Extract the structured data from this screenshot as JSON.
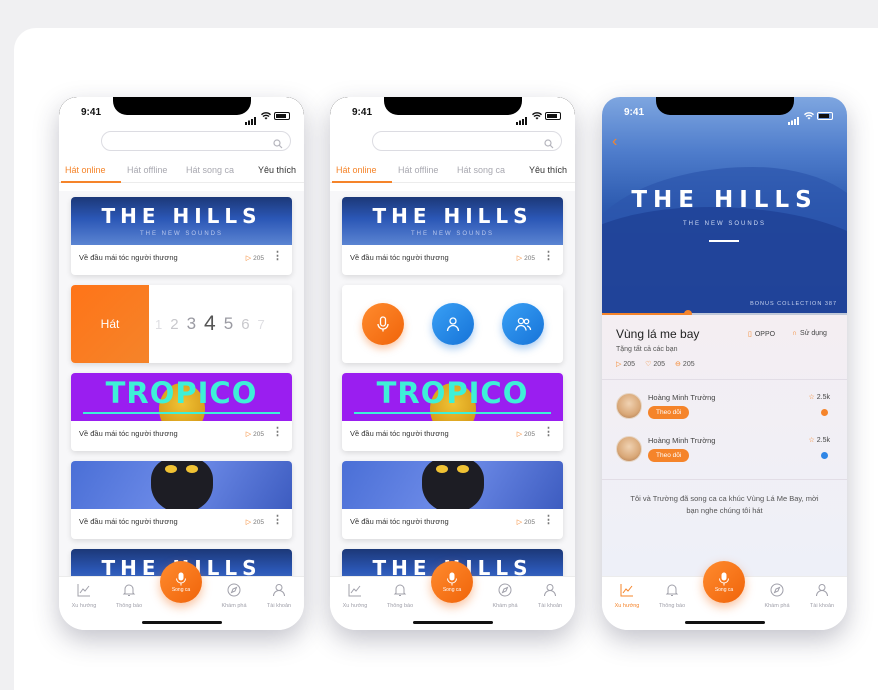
{
  "status": {
    "time": "9:41"
  },
  "tabs": [
    "Hát online",
    "Hát offline",
    "Hát song ca",
    "Yêu thích"
  ],
  "songs": [
    {
      "banner_title": "THE HILLS",
      "banner_subtitle": "THE NEW SOUNDS",
      "title": "Về đầu mái tóc người thương",
      "plays": "205"
    },
    {
      "banner_title": "TROPICO",
      "title": "Về đầu mái tóc người thương",
      "plays": "205"
    },
    {
      "title": "Về đầu mái tóc người thương",
      "plays": "205"
    },
    {
      "banner_title": "THE HILLS"
    }
  ],
  "number_card": {
    "label": "Hát",
    "numbers": [
      "1",
      "2",
      "3",
      "4",
      "5",
      "6",
      "7"
    ]
  },
  "nav": {
    "items": [
      "Xu hướng",
      "Thông báo",
      "Khám phá",
      "Tài khoản"
    ],
    "fab_label": "Song ca"
  },
  "detail": {
    "hero_title": "THE HILLS",
    "hero_subtitle": "THE NEW SOUNDS",
    "collection": "BONUS COLLECTION 387",
    "song_title": "Vùng lá me bay",
    "subtitle": "Tặng tất cả các bạn",
    "device": "OPPO",
    "use_label": "Sử dụng",
    "plays": "205",
    "likes": "205",
    "comments": "205",
    "progress": 0.35,
    "users": [
      {
        "name": "Hoàng Minh Trường",
        "follow": "Theo dõi",
        "score": "2.5k",
        "dot_color": "#f5842a"
      },
      {
        "name": "Hoàng Minh Trường",
        "follow": "Theo dõi",
        "score": "2.5k",
        "dot_color": "#2f86e6"
      }
    ],
    "message": "Tôi và Trường đã song ca ca khúc Vùng Lá Me Bay, mời bạn nghe chúng tôi hát"
  },
  "colors": {
    "accent": "#f5842a",
    "blue": "#2f86e6",
    "purple": "#9a1ef0",
    "teal": "#3ef0d8"
  }
}
